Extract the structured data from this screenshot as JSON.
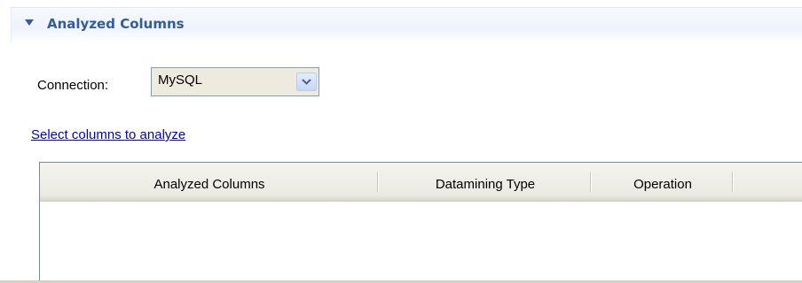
{
  "section": {
    "title": "Analyzed Columns",
    "expanded": true,
    "toggle_icon": "triangle-down-icon",
    "title_color": "#335c99"
  },
  "connection": {
    "label": "Connection:",
    "selected": "MySQL",
    "dropdown_icon": "chevron-down-icon"
  },
  "link": {
    "select_columns": "Select columns to analyze",
    "color": "#0000cc"
  },
  "table": {
    "columns": [
      "Analyzed Columns",
      "Datamining Type",
      "Operation",
      ""
    ],
    "rows": []
  }
}
